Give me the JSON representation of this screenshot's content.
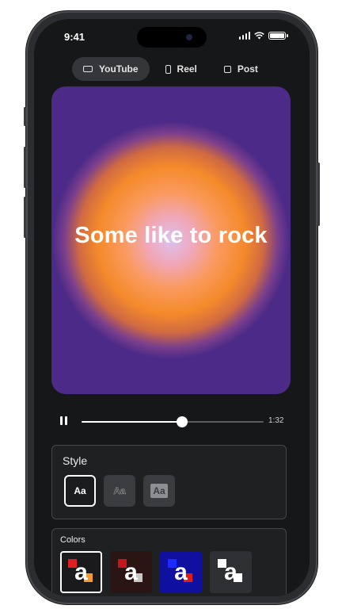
{
  "status_bar": {
    "time": "9:41"
  },
  "tabs": [
    {
      "label": "YouTube",
      "icon": "landscape-frame-icon",
      "active": true
    },
    {
      "label": "Reel",
      "icon": "portrait-frame-icon",
      "active": false
    },
    {
      "label": "Post",
      "icon": "square-frame-icon",
      "active": false
    }
  ],
  "artwork": {
    "title": "Some like to rock",
    "colors": {
      "center": "#dcc1ef",
      "mid": "#f58a2a",
      "edge": "#4b2a88"
    }
  },
  "playback": {
    "state": "playing",
    "progress_fraction": 0.55,
    "duration": "1:32"
  },
  "style_panel": {
    "title": "Style",
    "options": [
      {
        "label": "Aa",
        "variant": "solid",
        "selected": true
      },
      {
        "label": "Aa",
        "variant": "outline",
        "selected": false
      },
      {
        "label": "Aa",
        "variant": "boxed",
        "selected": false
      }
    ]
  },
  "colors_panel": {
    "title": "Colors",
    "swatches": [
      {
        "glyph": "a",
        "bg": "#1a1a1c",
        "text": "#ffffff",
        "accent1": "#e02020",
        "accent2": "#f59a2a",
        "selected": true
      },
      {
        "glyph": "a",
        "bg": "#2a1414",
        "text": "#ffffff",
        "accent1": "#c8151b",
        "accent2": "#c8c8c8",
        "selected": false
      },
      {
        "glyph": "a",
        "bg": "#1010a0",
        "text": "#ffffff",
        "accent1": "#1a2cff",
        "accent2": "#e01a1a",
        "selected": false
      },
      {
        "glyph": "a",
        "bg": "#2f3034",
        "text": "#ffffff",
        "accent1": "#ffffff",
        "accent2": "#ffffff",
        "selected": false
      }
    ]
  }
}
